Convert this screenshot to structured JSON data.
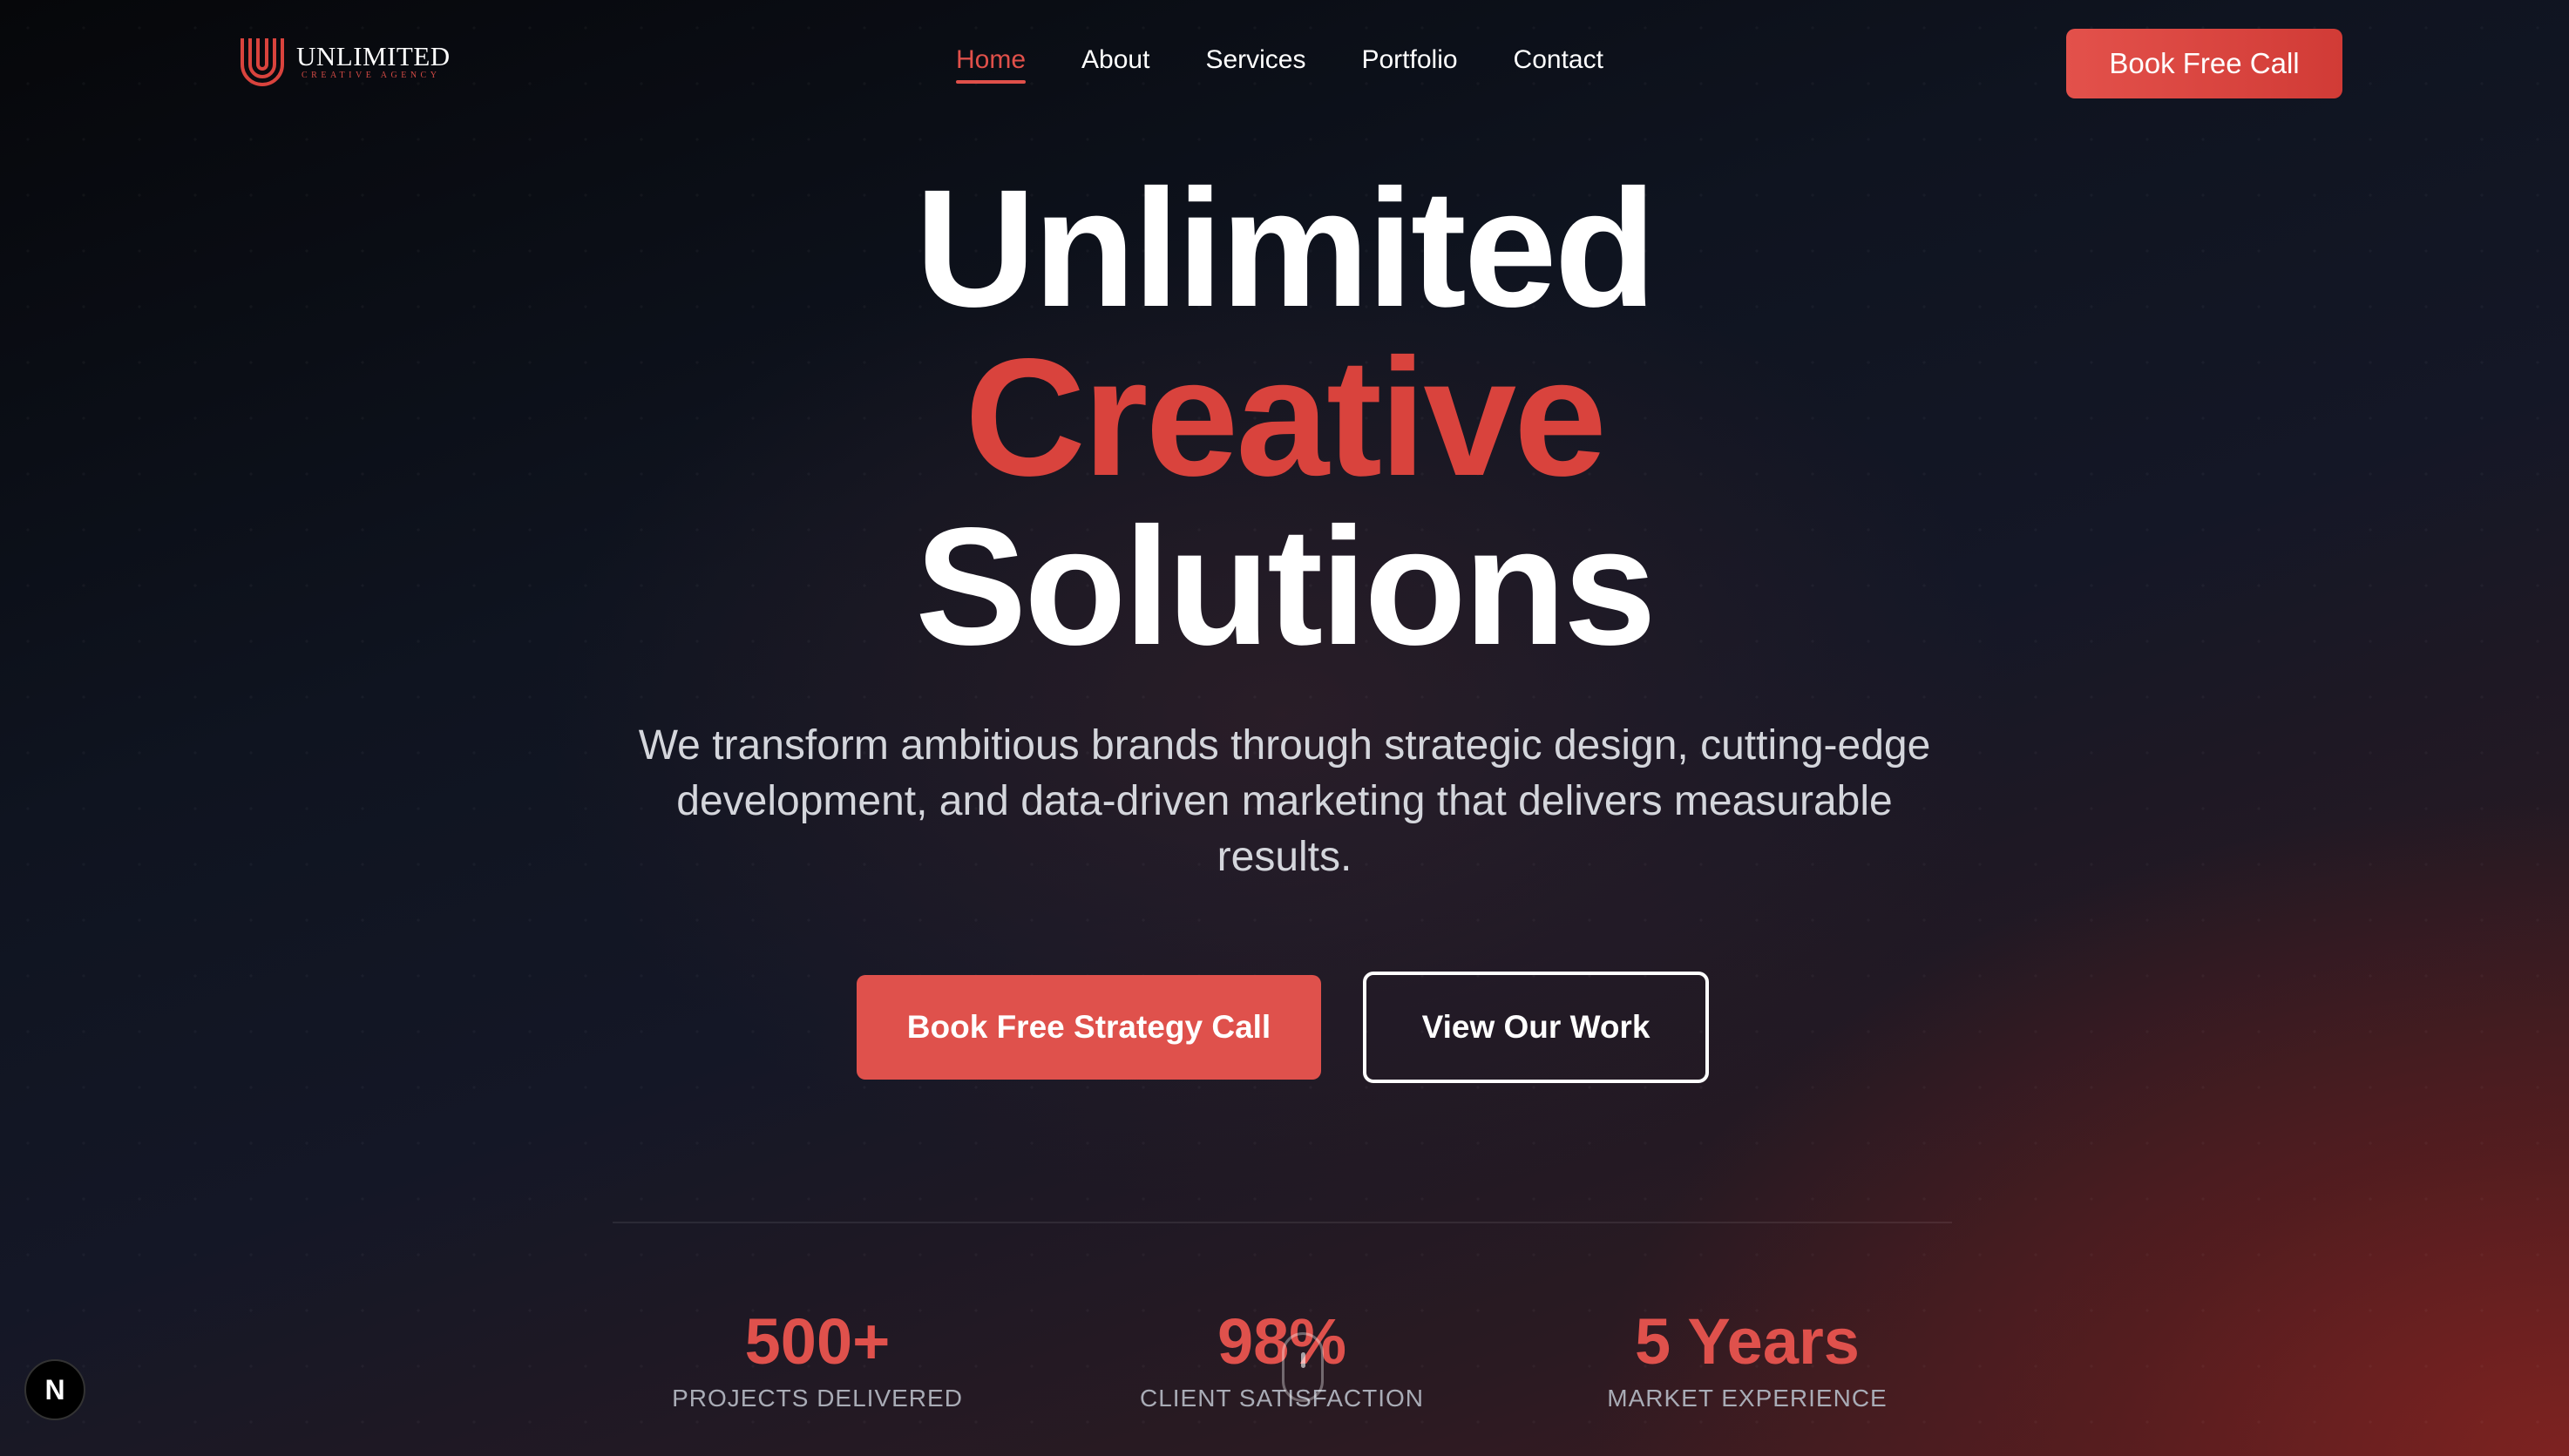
{
  "brand": {
    "name": "UNLIMITED",
    "tagline": "CREATIVE AGENCY",
    "logo_icon": "u-logo-icon"
  },
  "nav": {
    "items": [
      {
        "label": "Home",
        "active": true
      },
      {
        "label": "About",
        "active": false
      },
      {
        "label": "Services",
        "active": false
      },
      {
        "label": "Portfolio",
        "active": false
      },
      {
        "label": "Contact",
        "active": false
      }
    ],
    "cta_label": "Book Free Call"
  },
  "hero": {
    "title_line1": "Unlimited",
    "title_line2": "Creative",
    "title_line3": "Solutions",
    "subtitle": "We transform ambitious brands through strategic design, cutting-edge development, and data-driven marketing that delivers measurable results.",
    "primary_cta": "Book Free Strategy Call",
    "secondary_cta": "View Our Work"
  },
  "stats": [
    {
      "value": "500+",
      "label": "PROJECTS DELIVERED"
    },
    {
      "value": "98%",
      "label": "CLIENT SATISFACTION"
    },
    {
      "value": "5 Years",
      "label": "MARKET EXPERIENCE"
    }
  ],
  "devtools": {
    "badge": "N",
    "icon": "nextjs-icon"
  },
  "scroll_indicator_icon": "mouse-scroll-icon",
  "colors": {
    "accent": "#df514c",
    "background": "#0b0d12",
    "text": "#ffffff",
    "muted": "#a9acb6"
  }
}
